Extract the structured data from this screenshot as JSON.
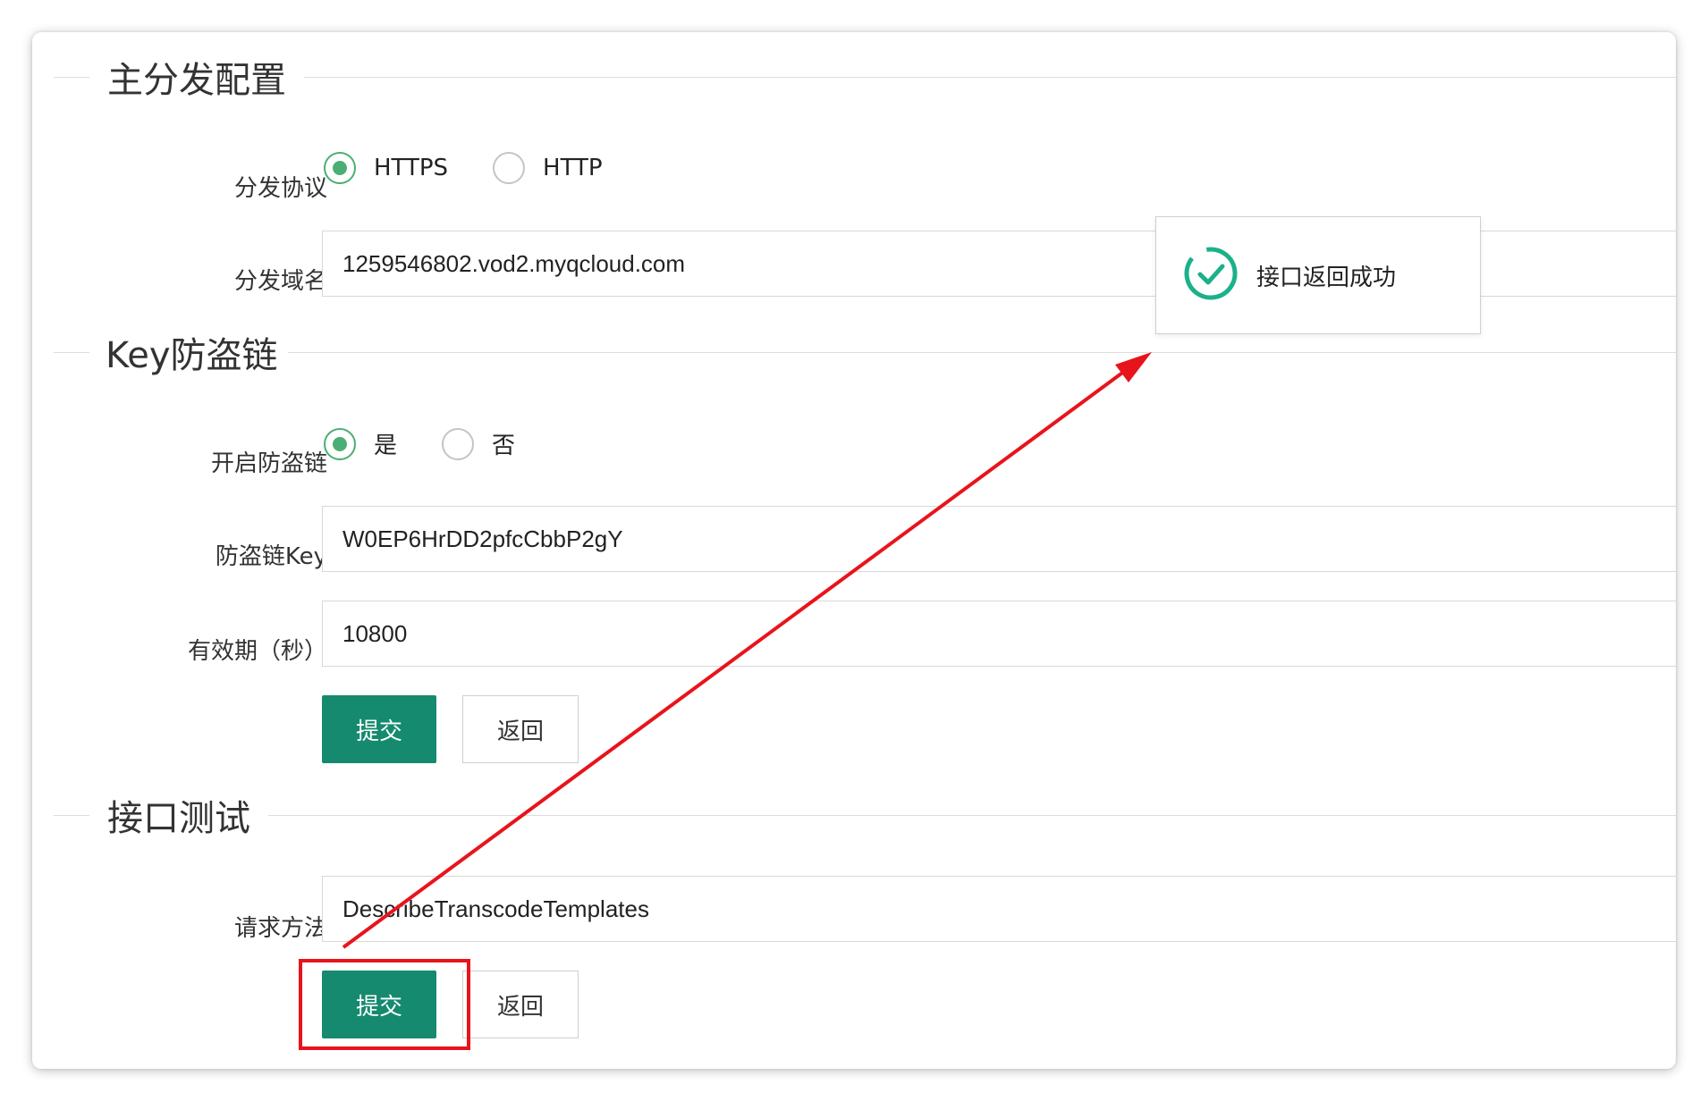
{
  "main_distribution": {
    "title": "主分发配置",
    "protocol_label": "分发协议",
    "protocol_options": [
      "HTTPS",
      "HTTP"
    ],
    "protocol_selected": "HTTPS",
    "domain_label": "分发域名",
    "domain_value": "1259546802.vod2.myqcloud.com"
  },
  "key_hotlink": {
    "title": "Key防盗链",
    "enable_label": "开启防盗链",
    "enable_options": [
      "是",
      "否"
    ],
    "enable_selected": "是",
    "key_label": "防盗链Key",
    "key_value": "W0EP6HrDD2pfcCbbP2gY",
    "expiry_label": "有效期（秒）",
    "expiry_value": "10800",
    "submit_label": "提交",
    "back_label": "返回"
  },
  "api_test": {
    "title": "接口测试",
    "method_label": "请求方法",
    "method_value": "DescribeTranscodeTemplates",
    "submit_label": "提交",
    "back_label": "返回"
  },
  "toast": {
    "message": "接口返回成功",
    "icon": "check-circle-icon"
  },
  "colors": {
    "primary": "#158a6f",
    "radio_checked": "#4cae74",
    "success": "#1bb18a",
    "annotation": "#e8141c"
  }
}
